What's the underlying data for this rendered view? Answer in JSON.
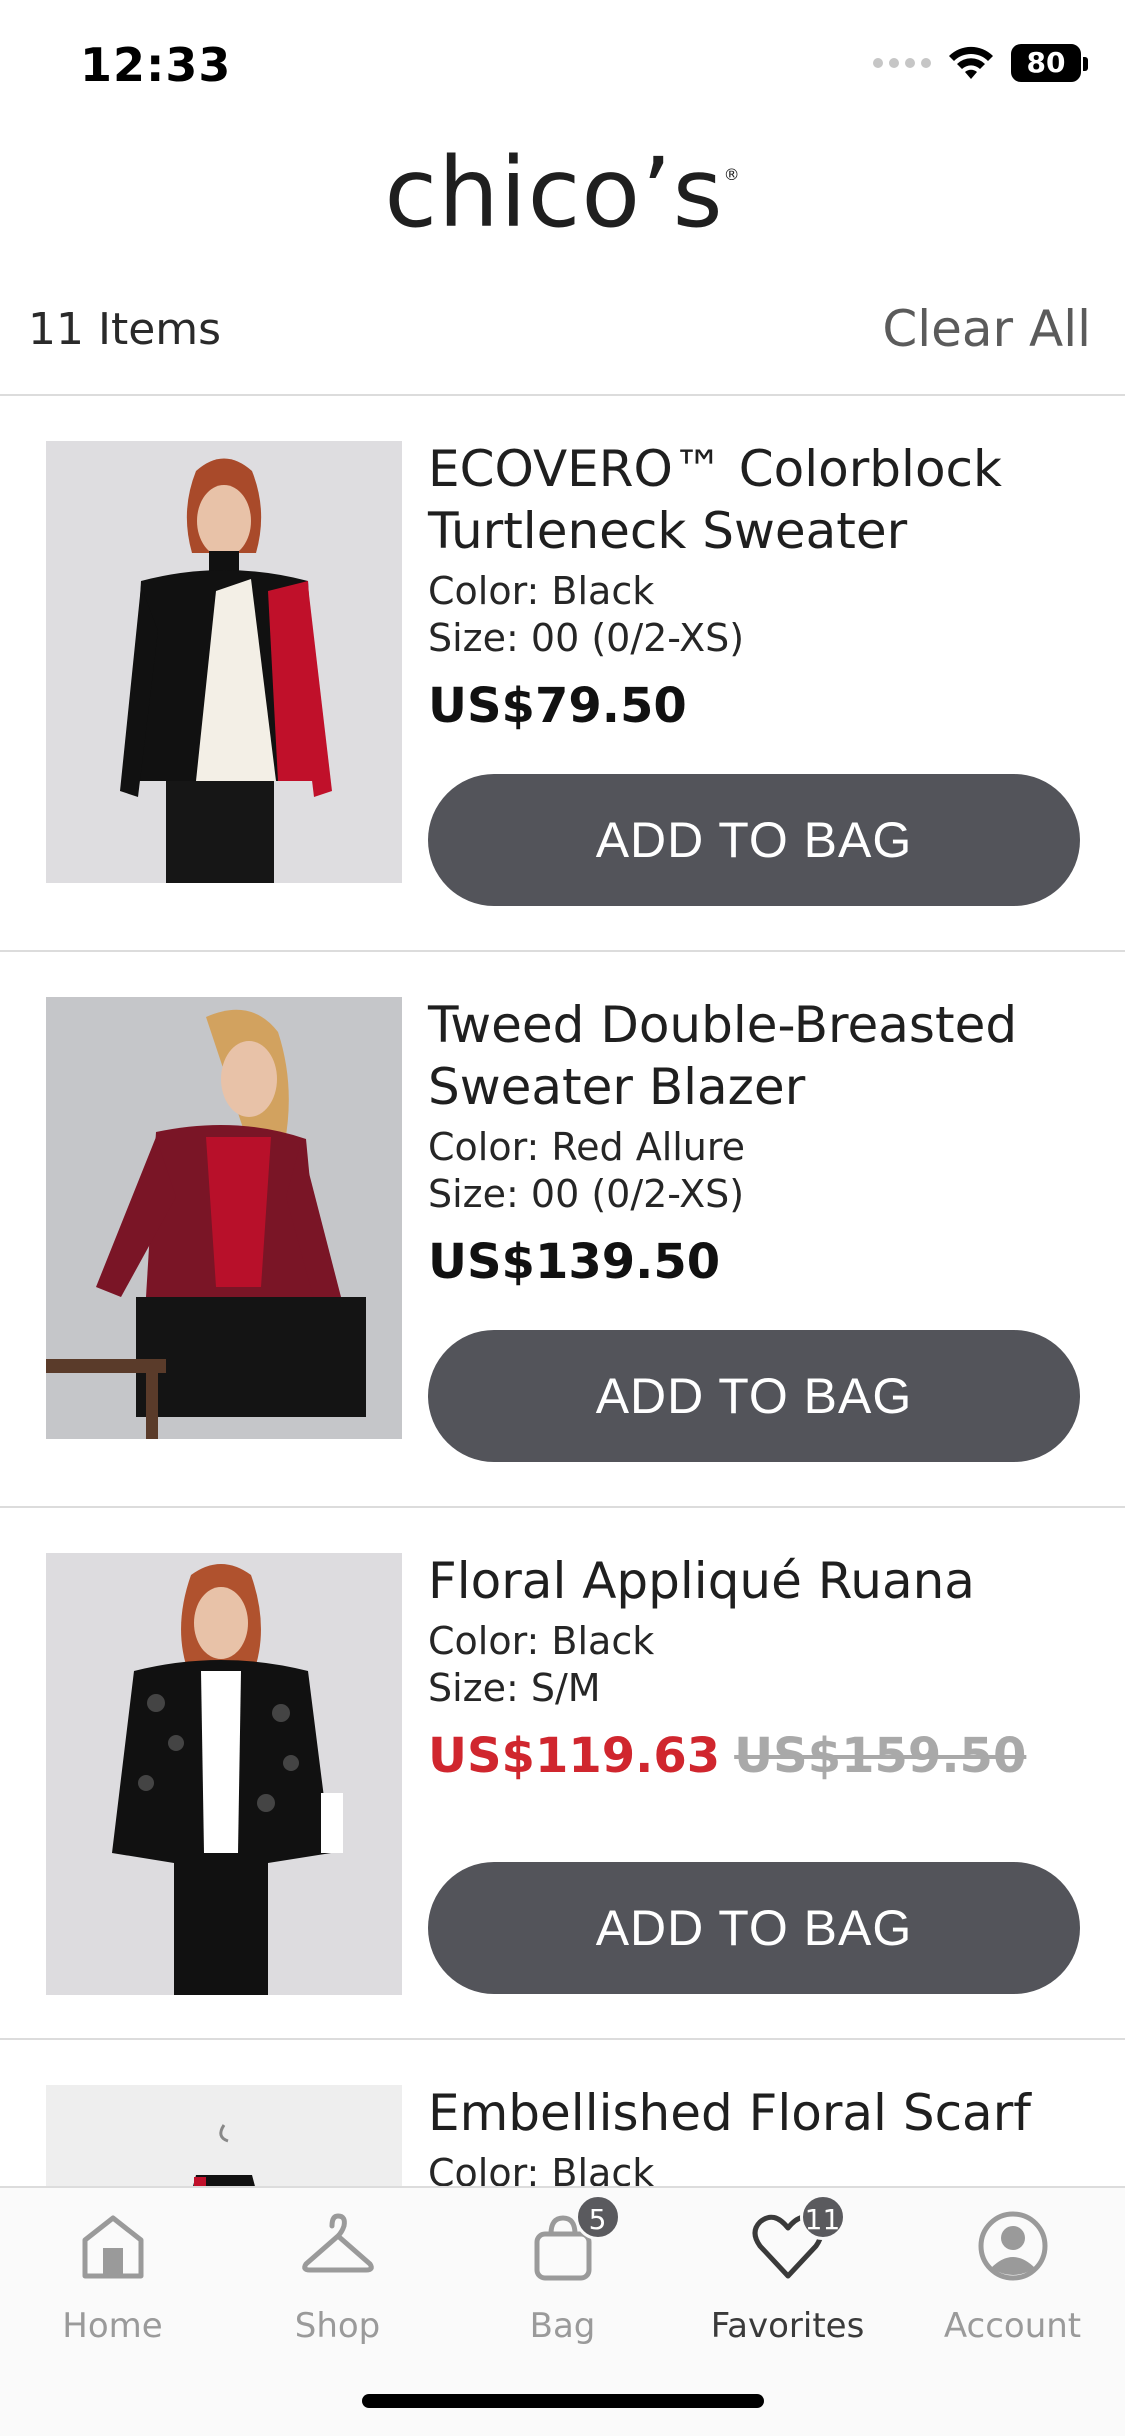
{
  "status_bar": {
    "time": "12:33",
    "battery": "80"
  },
  "brand": {
    "logo": "chico’s"
  },
  "list_header": {
    "count": "11 Items",
    "clear_all": "Clear All"
  },
  "products": [
    {
      "name": "ECOVERO™ Colorblock Turtleneck Sweater",
      "color": "Color: Black",
      "size": "Size: 00 (0/2-XS)",
      "price": "US$79.50",
      "button": "ADD TO BAG"
    },
    {
      "name": "Tweed Double-Breasted Sweater Blazer",
      "color": "Color: Red Allure",
      "size": "Size: 00 (0/2-XS)",
      "price": "US$139.50",
      "button": "ADD TO BAG"
    },
    {
      "name": "Floral Appliqué Ruana",
      "color": "Color: Black",
      "size": "Size: S/M",
      "sale_price": "US$119.63",
      "original_price": "US$159.50",
      "button": "ADD TO BAG"
    },
    {
      "name": "Embellished Floral Scarf",
      "color": "Color: Black"
    }
  ],
  "nav": {
    "home": "Home",
    "shop": "Shop",
    "bag": "Bag",
    "bag_badge": "5",
    "favorites": "Favorites",
    "favorites_badge": "11",
    "account": "Account"
  },
  "colors": {
    "button": "#53545a",
    "sale": "#d0262e",
    "strike": "#a9a9a9"
  }
}
